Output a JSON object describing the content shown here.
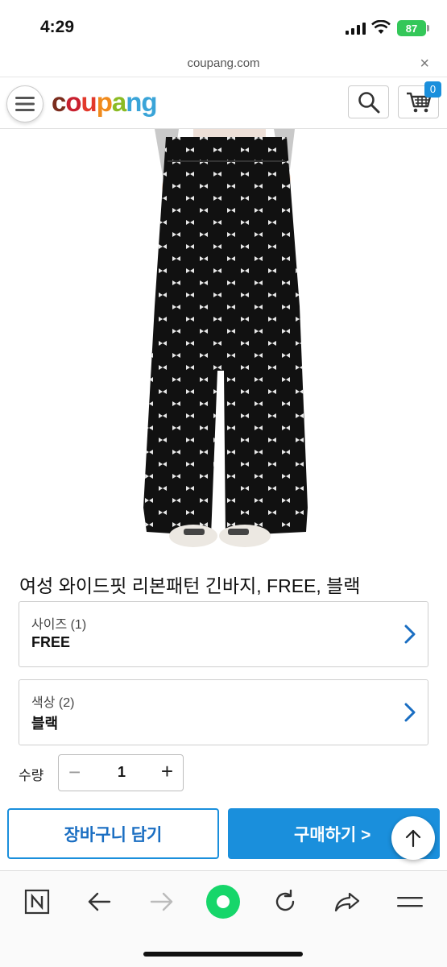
{
  "status_bar": {
    "time": "4:29",
    "battery": "87"
  },
  "browser": {
    "url": "coupang.com",
    "close_label": "×"
  },
  "header": {
    "logo_letters": [
      {
        "char": "c",
        "color": "#7b2d1e"
      },
      {
        "char": "o",
        "color": "#c8202f"
      },
      {
        "char": "u",
        "color": "#e2392b"
      },
      {
        "char": "p",
        "color": "#f08a1c"
      },
      {
        "char": "a",
        "color": "#8bbb24"
      },
      {
        "char": "n",
        "color": "#3aa4d8"
      },
      {
        "char": "g",
        "color": "#3aa4d8"
      }
    ],
    "cart_count": "0",
    "icons": [
      "hamburger-menu-icon",
      "search-icon",
      "shopping-cart-icon"
    ]
  },
  "product": {
    "title": "여성 와이드핏 리본패턴 긴바지, FREE, 블랙",
    "options": [
      {
        "label": "사이즈 (1)",
        "value": "FREE"
      },
      {
        "label": "색상 (2)",
        "value": "블랙"
      }
    ],
    "quantity_label": "수량",
    "quantity": "1",
    "minus": "−",
    "plus": "+"
  },
  "actions": {
    "add_to_cart": "장바구니 담기",
    "buy_now": "구매하기 >"
  },
  "bottom_nav": {
    "items": [
      "naver-n-icon",
      "back-arrow-icon",
      "forward-arrow-icon",
      "green-circle-icon",
      "refresh-icon",
      "share-icon",
      "hamburger-menu-icon"
    ]
  },
  "colors": {
    "accent_blue": "#1a8fdc",
    "green": "#16d66a",
    "battery_green": "#34c759"
  }
}
